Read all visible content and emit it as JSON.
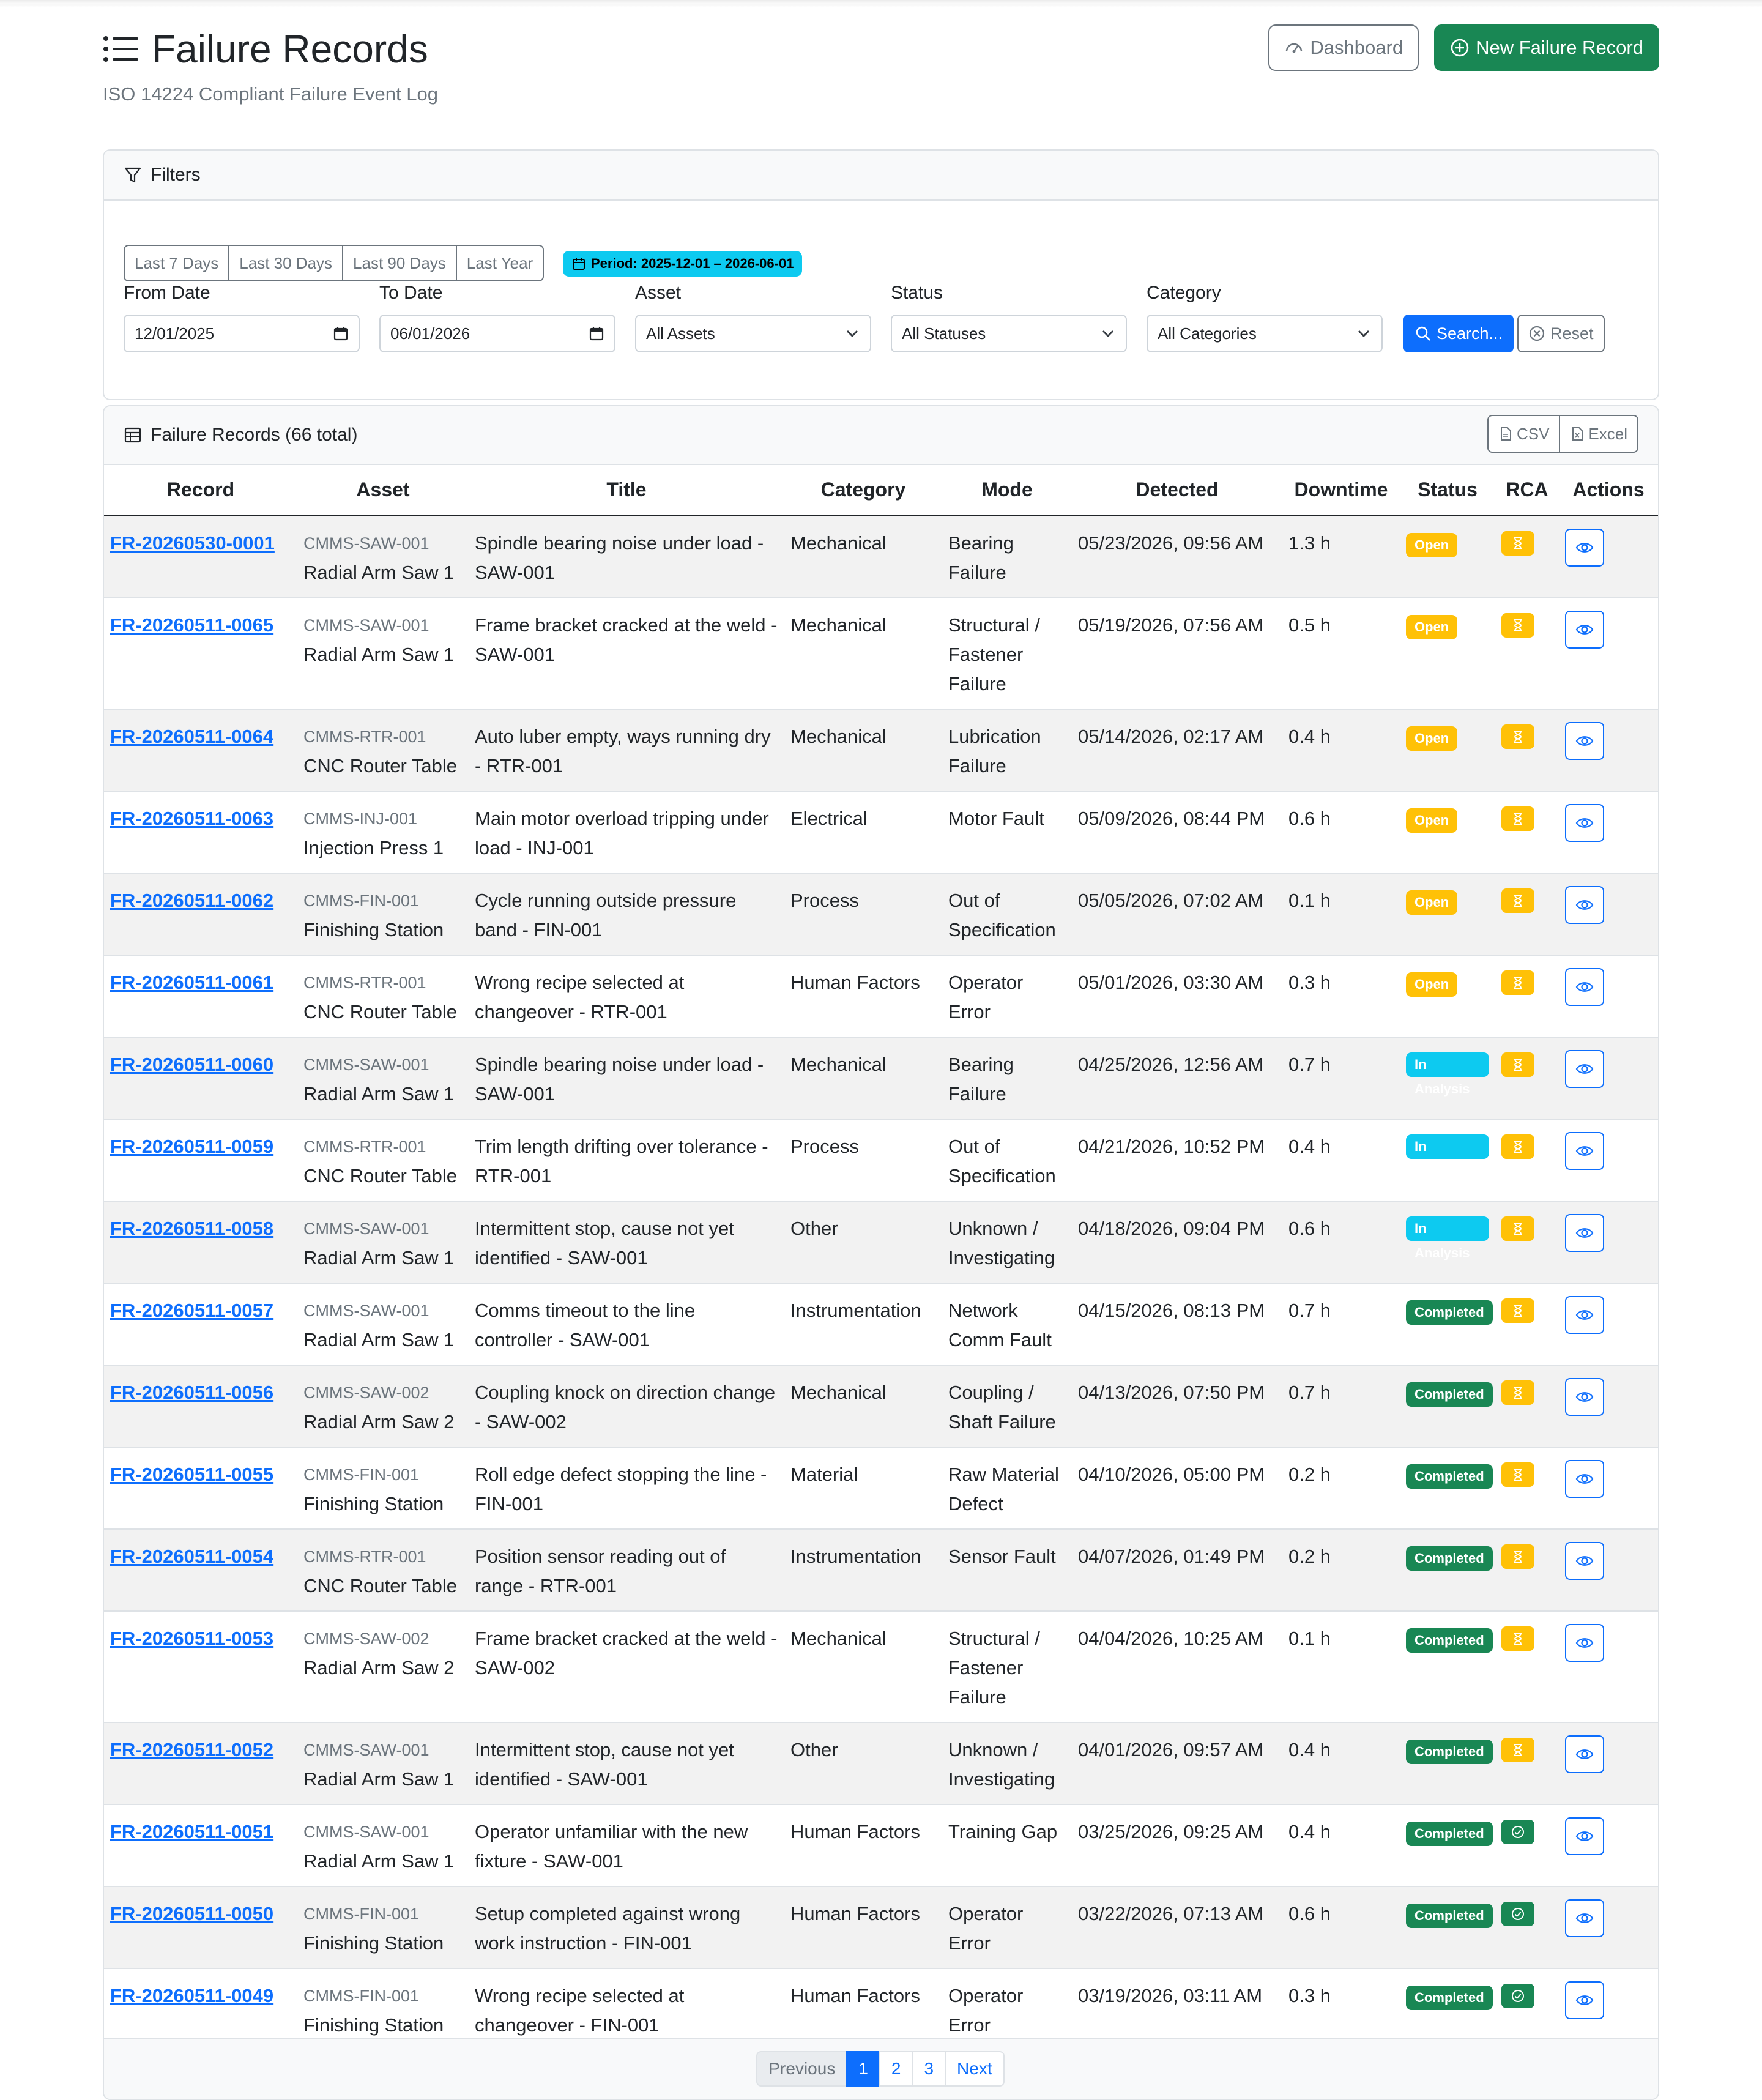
{
  "header": {
    "title": "Failure Records",
    "subtitle": "ISO 14224 Compliant Failure Event Log",
    "dashboard_label": "Dashboard",
    "new_label": "New Failure Record"
  },
  "filters": {
    "title": "Filters",
    "quick": [
      "Last 7 Days",
      "Last 30 Days",
      "Last 90 Days",
      "Last Year"
    ],
    "period": "Period: 2025-12-01 – 2026-06-01",
    "from_label": "From Date",
    "from_value": "12/01/2025",
    "to_label": "To Date",
    "to_value": "06/01/2026",
    "asset_label": "Asset",
    "asset_value": "All Assets",
    "status_label": "Status",
    "status_value": "All Statuses",
    "category_label": "Category",
    "category_value": "All Categories",
    "search_label": "Search...",
    "reset_label": "Reset"
  },
  "records": {
    "title": "Failure Records (66 total)",
    "csv_label": "CSV",
    "excel_label": "Excel",
    "columns": [
      "Record",
      "Asset",
      "Title",
      "Category",
      "Mode",
      "Detected",
      "Downtime",
      "Status",
      "RCA",
      "Actions"
    ],
    "rows": [
      {
        "id": "FR-20260530-0001",
        "asset_code": "CMMS-SAW-001",
        "asset_name": "Radial Arm Saw 1",
        "title": "Spindle bearing noise under load - SAW-001",
        "category": "Mechanical",
        "mode": "Bearing Failure",
        "detected": "05/23/2026, 09:56 AM",
        "downtime": "1.3 h",
        "status": "Open",
        "rca": "pending"
      },
      {
        "id": "FR-20260511-0065",
        "asset_code": "CMMS-SAW-001",
        "asset_name": "Radial Arm Saw 1",
        "title": "Frame bracket cracked at the weld - SAW-001",
        "category": "Mechanical",
        "mode": "Structural / Fastener Failure",
        "detected": "05/19/2026, 07:56 AM",
        "downtime": "0.5 h",
        "status": "Open",
        "rca": "pending"
      },
      {
        "id": "FR-20260511-0064",
        "asset_code": "CMMS-RTR-001",
        "asset_name": "CNC Router Table",
        "title": "Auto luber empty, ways running dry - RTR-001",
        "category": "Mechanical",
        "mode": "Lubrication Failure",
        "detected": "05/14/2026, 02:17 AM",
        "downtime": "0.4 h",
        "status": "Open",
        "rca": "pending"
      },
      {
        "id": "FR-20260511-0063",
        "asset_code": "CMMS-INJ-001",
        "asset_name": "Injection Press 1",
        "title": "Main motor overload tripping under load - INJ-001",
        "category": "Electrical",
        "mode": "Motor Fault",
        "detected": "05/09/2026, 08:44 PM",
        "downtime": "0.6 h",
        "status": "Open",
        "rca": "pending"
      },
      {
        "id": "FR-20260511-0062",
        "asset_code": "CMMS-FIN-001",
        "asset_name": "Finishing Station",
        "title": "Cycle running outside pressure band - FIN-001",
        "category": "Process",
        "mode": "Out of Specification",
        "detected": "05/05/2026, 07:02 AM",
        "downtime": "0.1 h",
        "status": "Open",
        "rca": "pending"
      },
      {
        "id": "FR-20260511-0061",
        "asset_code": "CMMS-RTR-001",
        "asset_name": "CNC Router Table",
        "title": "Wrong recipe selected at changeover - RTR-001",
        "category": "Human Factors",
        "mode": "Operator Error",
        "detected": "05/01/2026, 03:30 AM",
        "downtime": "0.3 h",
        "status": "Open",
        "rca": "pending"
      },
      {
        "id": "FR-20260511-0060",
        "asset_code": "CMMS-SAW-001",
        "asset_name": "Radial Arm Saw 1",
        "title": "Spindle bearing noise under load - SAW-001",
        "category": "Mechanical",
        "mode": "Bearing Failure",
        "detected": "04/25/2026, 12:56 AM",
        "downtime": "0.7 h",
        "status": "In Analysis",
        "rca": "pending"
      },
      {
        "id": "FR-20260511-0059",
        "asset_code": "CMMS-RTR-001",
        "asset_name": "CNC Router Table",
        "title": "Trim length drifting over tolerance - RTR-001",
        "category": "Process",
        "mode": "Out of Specification",
        "detected": "04/21/2026, 10:52 PM",
        "downtime": "0.4 h",
        "status": "In Analysis",
        "rca": "pending"
      },
      {
        "id": "FR-20260511-0058",
        "asset_code": "CMMS-SAW-001",
        "asset_name": "Radial Arm Saw 1",
        "title": "Intermittent stop, cause not yet identified - SAW-001",
        "category": "Other",
        "mode": "Unknown / Investigating",
        "detected": "04/18/2026, 09:04 PM",
        "downtime": "0.6 h",
        "status": "In Analysis",
        "rca": "pending"
      },
      {
        "id": "FR-20260511-0057",
        "asset_code": "CMMS-SAW-001",
        "asset_name": "Radial Arm Saw 1",
        "title": "Comms timeout to the line controller - SAW-001",
        "category": "Instrumentation",
        "mode": "Network Comm Fault",
        "detected": "04/15/2026, 08:13 PM",
        "downtime": "0.7 h",
        "status": "Completed",
        "rca": "pending"
      },
      {
        "id": "FR-20260511-0056",
        "asset_code": "CMMS-SAW-002",
        "asset_name": "Radial Arm Saw 2",
        "title": "Coupling knock on direction change - SAW-002",
        "category": "Mechanical",
        "mode": "Coupling / Shaft Failure",
        "detected": "04/13/2026, 07:50 PM",
        "downtime": "0.7 h",
        "status": "Completed",
        "rca": "pending"
      },
      {
        "id": "FR-20260511-0055",
        "asset_code": "CMMS-FIN-001",
        "asset_name": "Finishing Station",
        "title": "Roll edge defect stopping the line - FIN-001",
        "category": "Material",
        "mode": "Raw Material Defect",
        "detected": "04/10/2026, 05:00 PM",
        "downtime": "0.2 h",
        "status": "Completed",
        "rca": "pending"
      },
      {
        "id": "FR-20260511-0054",
        "asset_code": "CMMS-RTR-001",
        "asset_name": "CNC Router Table",
        "title": "Position sensor reading out of range - RTR-001",
        "category": "Instrumentation",
        "mode": "Sensor Fault",
        "detected": "04/07/2026, 01:49 PM",
        "downtime": "0.2 h",
        "status": "Completed",
        "rca": "pending"
      },
      {
        "id": "FR-20260511-0053",
        "asset_code": "CMMS-SAW-002",
        "asset_name": "Radial Arm Saw 2",
        "title": "Frame bracket cracked at the weld - SAW-002",
        "category": "Mechanical",
        "mode": "Structural / Fastener Failure",
        "detected": "04/04/2026, 10:25 AM",
        "downtime": "0.1 h",
        "status": "Completed",
        "rca": "pending"
      },
      {
        "id": "FR-20260511-0052",
        "asset_code": "CMMS-SAW-001",
        "asset_name": "Radial Arm Saw 1",
        "title": "Intermittent stop, cause not yet identified - SAW-001",
        "category": "Other",
        "mode": "Unknown / Investigating",
        "detected": "04/01/2026, 09:57 AM",
        "downtime": "0.4 h",
        "status": "Completed",
        "rca": "pending"
      },
      {
        "id": "FR-20260511-0051",
        "asset_code": "CMMS-SAW-001",
        "asset_name": "Radial Arm Saw 1",
        "title": "Operator unfamiliar with the new fixture - SAW-001",
        "category": "Human Factors",
        "mode": "Training Gap",
        "detected": "03/25/2026, 09:25 AM",
        "downtime": "0.4 h",
        "status": "Completed",
        "rca": "done"
      },
      {
        "id": "FR-20260511-0050",
        "asset_code": "CMMS-FIN-001",
        "asset_name": "Finishing Station",
        "title": "Setup completed against wrong work instruction - FIN-001",
        "category": "Human Factors",
        "mode": "Operator Error",
        "detected": "03/22/2026, 07:13 AM",
        "downtime": "0.6 h",
        "status": "Completed",
        "rca": "done"
      },
      {
        "id": "FR-20260511-0049",
        "asset_code": "CMMS-FIN-001",
        "asset_name": "Finishing Station",
        "title": "Wrong recipe selected at changeover - FIN-001",
        "category": "Human Factors",
        "mode": "Operator Error",
        "detected": "03/19/2026, 03:11 AM",
        "downtime": "0.3 h",
        "status": "Completed",
        "rca": "done"
      }
    ]
  },
  "pagination": {
    "previous": "Previous",
    "pages": [
      "1",
      "2",
      "3"
    ],
    "next": "Next"
  },
  "colors": {
    "primary": "#0d6efd",
    "success": "#198754",
    "warning": "#ffc107",
    "info": "#0dcaf0"
  }
}
